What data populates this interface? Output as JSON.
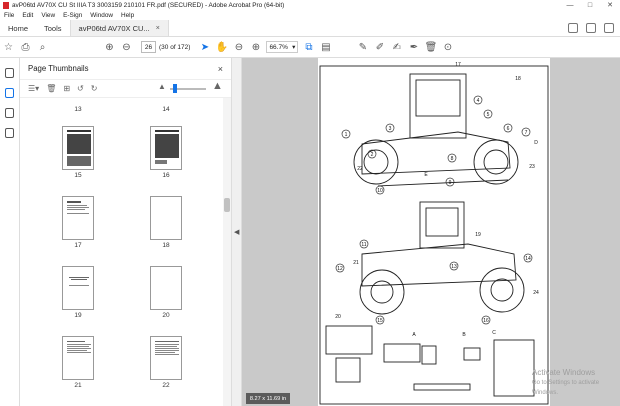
{
  "window": {
    "title": "avP06td AV70X CU St IIIA T3 3003159 210101 FR.pdf (SECURED) - Adobe Acrobat Pro (64-bit)",
    "controls": [
      "—",
      "□",
      "✕"
    ]
  },
  "menu": [
    "File",
    "Edit",
    "View",
    "E-Sign",
    "Window",
    "Help"
  ],
  "tabs": {
    "home": "Home",
    "tools": "Tools",
    "document": "avP06td AV70X CU...",
    "close": "×"
  },
  "toolbar": {
    "page_current": "26",
    "page_count": "(30 of 172)",
    "zoom": "66.7%"
  },
  "panel": {
    "title": "Page Thumbnails",
    "close": "×",
    "thumbnails": [
      {
        "label": "13"
      },
      {
        "label": "14"
      },
      {
        "label": "15"
      },
      {
        "label": "16"
      },
      {
        "label": "17"
      },
      {
        "label": "18"
      },
      {
        "label": "19"
      },
      {
        "label": "20"
      },
      {
        "label": "21"
      },
      {
        "label": "22"
      }
    ]
  },
  "document": {
    "callouts": [
      "1",
      "2",
      "3",
      "4",
      "5",
      "6",
      "7",
      "8",
      "9",
      "10",
      "11",
      "12",
      "13",
      "14",
      "15",
      "16",
      "17",
      "18",
      "19",
      "20",
      "21",
      "22",
      "23",
      "24",
      "A",
      "B",
      "C",
      "D",
      "E"
    ]
  },
  "status": {
    "page_size": "8.27 x 11.69 in"
  },
  "watermark": {
    "line1": "Activate Windows",
    "line2": "Go to Settings to activate Windows."
  },
  "colors": {
    "accent": "#1473e6",
    "adobe_red": "#d6262b",
    "viewer_bg": "#c9c9c9"
  }
}
